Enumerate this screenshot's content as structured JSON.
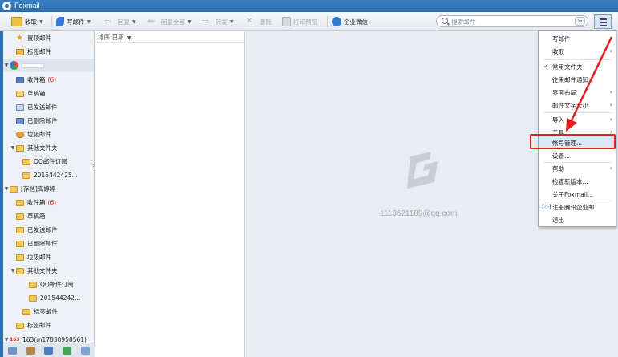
{
  "window": {
    "title": "Foxmail"
  },
  "toolbar": {
    "receive": "收取",
    "compose": "写邮件",
    "reply": "回复",
    "reply_all": "回复全部",
    "forward": "转发",
    "delete": "删除",
    "print_preview": "打印预览",
    "enterprise_wechat": "企业微信",
    "search_placeholder": "搜索邮件"
  },
  "sidebar": {
    "top_items": [
      "置顶邮件",
      "标签邮件"
    ],
    "account1": {
      "folders": [
        {
          "label": "收件箱",
          "count": "(6)"
        },
        {
          "label": "草稿箱"
        },
        {
          "label": "已发送邮件"
        },
        {
          "label": "已删除邮件"
        },
        {
          "label": "垃圾邮件"
        },
        {
          "label": "其他文件夹"
        },
        {
          "label": "QQ邮件订阅"
        },
        {
          "label": "2015442425..."
        }
      ]
    },
    "account2": {
      "name": "[存档]高婷婷",
      "folders": [
        {
          "label": "收件箱",
          "count": "(6)"
        },
        {
          "label": "草稿箱"
        },
        {
          "label": "已发送邮件"
        },
        {
          "label": "已删除邮件"
        },
        {
          "label": "垃圾邮件"
        },
        {
          "label": "其他文件夹"
        },
        {
          "label": "QQ邮件订阅"
        },
        {
          "label": "201544242..."
        },
        {
          "label": "标签邮件"
        }
      ],
      "tag_mail": "标签邮件"
    },
    "account3": {
      "prefix": "163",
      "name": "163(m17830958561)"
    }
  },
  "list": {
    "sort_label": "排序:日期"
  },
  "preview": {
    "email": "1113621189@qq.com"
  },
  "menu": {
    "items": [
      {
        "label": "写邮件"
      },
      {
        "label": "收取"
      },
      {
        "label": "常用文件夹"
      },
      {
        "label": "往来邮件通知"
      },
      {
        "label": "界面布局"
      },
      {
        "label": "邮件文字大小"
      },
      {
        "label": "导入"
      },
      {
        "label": "工具"
      },
      {
        "label": "帐号管理..."
      },
      {
        "label": "设置..."
      },
      {
        "label": "帮助"
      },
      {
        "label": "检查新版本..."
      },
      {
        "label": "关于Foxmail..."
      },
      {
        "label": "注册腾讯企业邮"
      },
      {
        "label": "退出"
      }
    ]
  },
  "colors": {
    "accent": "#2b6aa8",
    "highlight_box": "#e02020",
    "menu_hover": "#dbe8f7"
  }
}
